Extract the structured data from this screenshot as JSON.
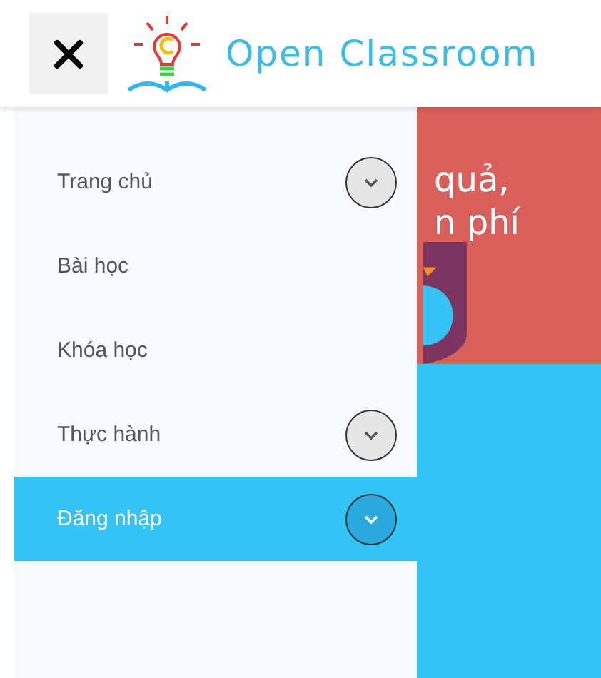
{
  "header": {
    "title": "Open Classroom"
  },
  "menu": {
    "items": [
      {
        "label": "Trang chủ",
        "expandable": true,
        "selected": false
      },
      {
        "label": "Bài học",
        "expandable": false,
        "selected": false
      },
      {
        "label": "Khóa học",
        "expandable": false,
        "selected": false
      },
      {
        "label": "Thực hành",
        "expandable": true,
        "selected": false
      },
      {
        "label": "Đăng nhập",
        "expandable": true,
        "selected": true
      }
    ]
  },
  "hero": {
    "lines": [
      "quả,",
      "n phí"
    ]
  }
}
